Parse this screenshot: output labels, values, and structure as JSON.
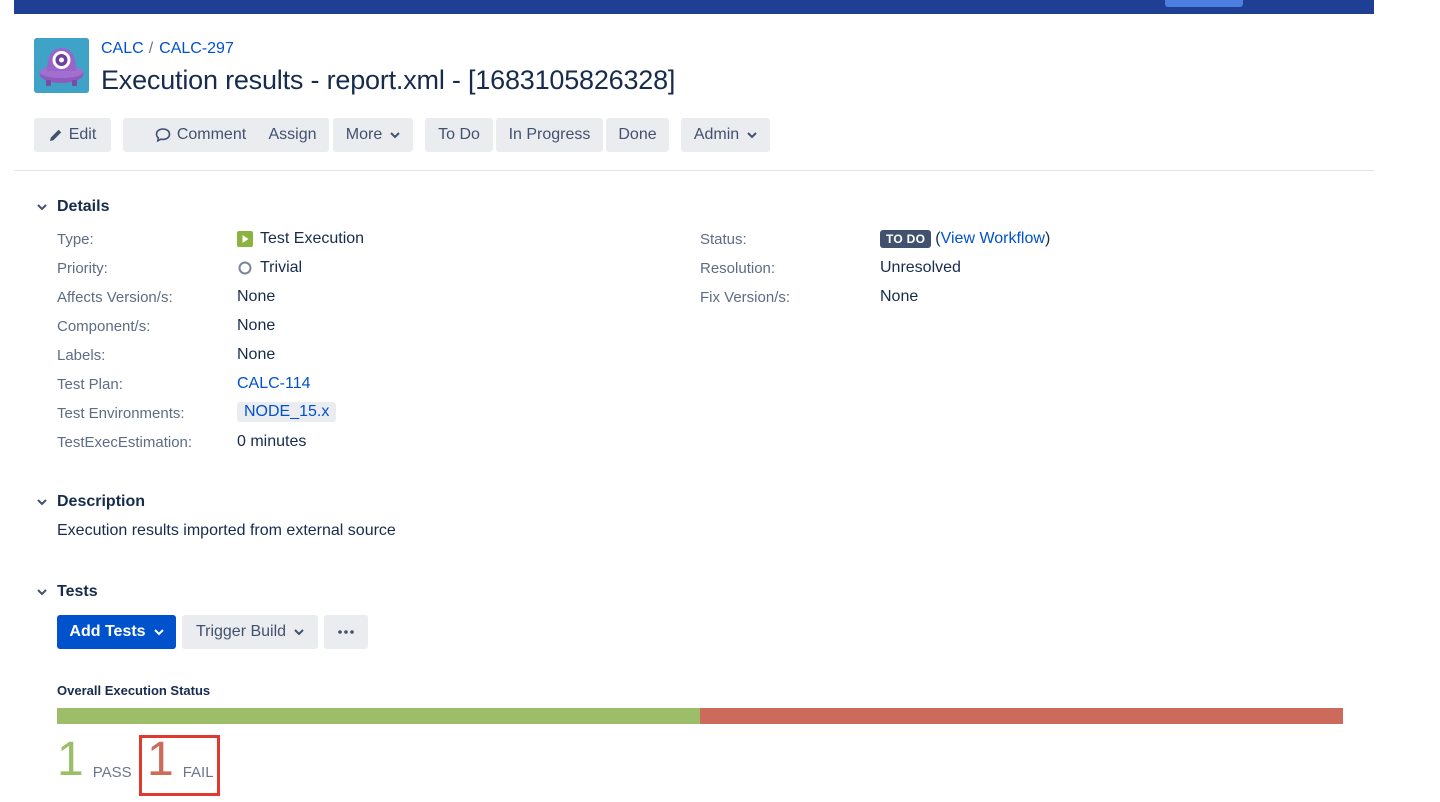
{
  "breadcrumbs": {
    "project": "CALC",
    "separator": "/",
    "issue_key": "CALC-297"
  },
  "issue": {
    "title": "Execution results - report.xml - [1683105826328]"
  },
  "toolbar": {
    "edit": "Edit",
    "comment": "Comment",
    "assign": "Assign",
    "more": "More",
    "todo": "To Do",
    "in_progress": "In Progress",
    "done": "Done",
    "admin": "Admin"
  },
  "details": {
    "heading": "Details",
    "left": [
      {
        "label": "Type:",
        "value": "Test Execution"
      },
      {
        "label": "Priority:",
        "value": "Trivial"
      },
      {
        "label": "Affects Version/s:",
        "value": "None"
      },
      {
        "label": "Component/s:",
        "value": "None"
      },
      {
        "label": "Labels:",
        "value": "None"
      },
      {
        "label": "Test Plan:",
        "value": "CALC-114"
      },
      {
        "label": "Test Environments:",
        "value": "NODE_15.x"
      },
      {
        "label": "TestExecEstimation:",
        "value": "0 minutes"
      }
    ],
    "right": {
      "status_label": "Status:",
      "status_lozenge": "TO DO",
      "open_paren": "(",
      "view_workflow": "View Workflow",
      "close_paren": ")",
      "resolution_label": "Resolution:",
      "resolution_value": "Unresolved",
      "fix_label": "Fix Version/s:",
      "fix_value": "None"
    }
  },
  "description": {
    "heading": "Description",
    "text": "Execution results imported from external source"
  },
  "tests": {
    "heading": "Tests",
    "add_tests": "Add Tests",
    "trigger_build": "Trigger Build",
    "overall_label": "Overall Execution Status",
    "pass_fraction": 0.5,
    "fail_fraction": 0.5,
    "pass_count": "1",
    "pass_label": "PASS",
    "fail_count": "1",
    "fail_label": "FAIL"
  },
  "colors": {
    "accent": "#0052cc",
    "topbar": "#1f3f94",
    "pass": "#9dbe68",
    "fail": "#cc6b5c",
    "highlight": "#e0392d"
  },
  "icons": [
    "project-avatar-icon",
    "pencil-icon",
    "comment-icon",
    "chevron-down-icon",
    "test-execution-icon",
    "priority-trivial-icon",
    "collapse-chevron-icon",
    "ellipsis-icon"
  ]
}
